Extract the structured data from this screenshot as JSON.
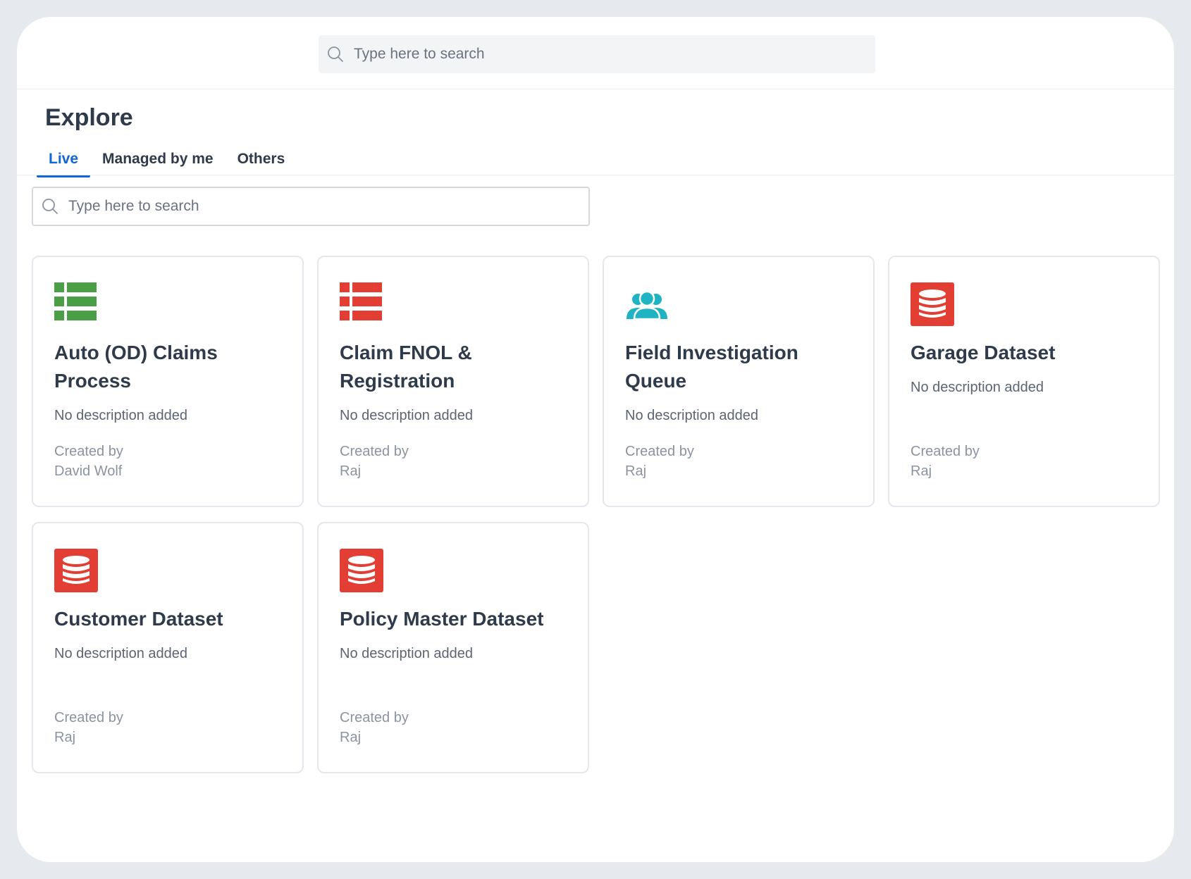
{
  "header": {
    "search_placeholder": "Type here to search"
  },
  "page": {
    "title": "Explore"
  },
  "tabs": [
    {
      "label": "Live",
      "active": true
    },
    {
      "label": "Managed by me",
      "active": false
    },
    {
      "label": "Others",
      "active": false
    }
  ],
  "list_search": {
    "placeholder": "Type here to search"
  },
  "colors": {
    "accent": "#1366d6",
    "process_green": "#4a9e45",
    "process_red": "#e33e33",
    "queue_teal": "#1fb3c4",
    "dataset_red": "#e33e33"
  },
  "cards": [
    {
      "icon": "table-grid-green-icon",
      "name": "Auto (OD) Claims Process",
      "description": "No description added",
      "created_label": "Created by",
      "created_by": "David Wolf"
    },
    {
      "icon": "table-grid-red-icon",
      "name": "Claim FNOL & Registration",
      "description": "No description added",
      "created_label": "Created by",
      "created_by": "Raj"
    },
    {
      "icon": "users-group-icon",
      "name": "Field Investigation Queue",
      "description": "No description added",
      "created_label": "Created by",
      "created_by": "Raj"
    },
    {
      "icon": "database-icon",
      "name": "Garage Dataset",
      "description": "No description added",
      "created_label": "Created by",
      "created_by": "Raj"
    },
    {
      "icon": "database-icon",
      "name": "Customer Dataset",
      "description": "No description added",
      "created_label": "Created by",
      "created_by": "Raj"
    },
    {
      "icon": "database-icon",
      "name": "Policy Master Dataset",
      "description": "No description added",
      "created_label": "Created by",
      "created_by": "Raj"
    }
  ]
}
